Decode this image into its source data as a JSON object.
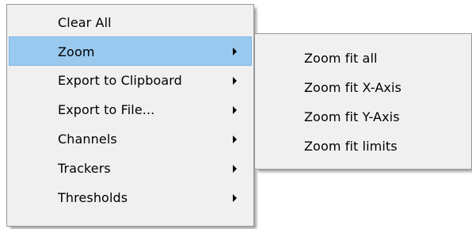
{
  "context_menu": {
    "items": [
      {
        "label": "Clear All",
        "has_submenu": false,
        "selected": false
      },
      {
        "label": "Zoom",
        "has_submenu": true,
        "selected": true
      },
      {
        "label": "Export to Clipboard",
        "has_submenu": true,
        "selected": false
      },
      {
        "label": "Export to File...",
        "has_submenu": true,
        "selected": false
      },
      {
        "label": "Channels",
        "has_submenu": true,
        "selected": false
      },
      {
        "label": "Trackers",
        "has_submenu": true,
        "selected": false
      },
      {
        "label": "Thresholds",
        "has_submenu": true,
        "selected": false
      }
    ]
  },
  "zoom_submenu": {
    "items": [
      {
        "label": "Zoom fit all"
      },
      {
        "label": "Zoom fit X-Axis"
      },
      {
        "label": "Zoom fit Y-Axis"
      },
      {
        "label": "Zoom fit limits"
      }
    ]
  },
  "colors": {
    "menu_background": "#f0f0f0",
    "selected_background": "#99c9ef",
    "selected_border": "#7eb4ea",
    "menu_border": "#979797"
  }
}
